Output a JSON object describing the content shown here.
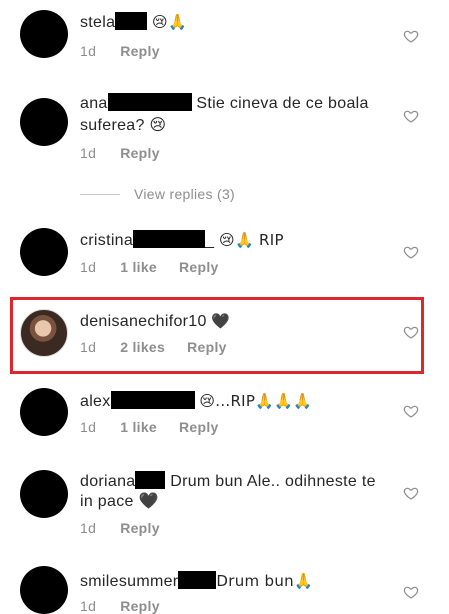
{
  "comments": [
    {
      "username": "stela",
      "text": "😢🙏",
      "time": "1d",
      "likes": "",
      "reply": "Reply"
    },
    {
      "username": "ana",
      "text": "Stie cineva de ce boala suferea? 😢",
      "line1": "Stie cineva de ce boala",
      "line2": "suferea? 😢",
      "time": "1d",
      "likes": "",
      "reply": "Reply"
    },
    {
      "username": "cristina",
      "suffix": "_",
      "text": "😢🙏 RIP",
      "time": "1d",
      "likes": "1 like",
      "reply": "Reply"
    },
    {
      "username": "denisanechifor10",
      "text": "🖤",
      "time": "1d",
      "likes": "2 likes",
      "reply": "Reply"
    },
    {
      "username": "alex",
      "text": "😢...RIP🙏🙏🙏",
      "time": "1d",
      "likes": "1 like",
      "reply": "Reply"
    },
    {
      "username": "doriana",
      "line1": "Drum bun Ale.. odihneste te",
      "line2": "in pace 🖤",
      "time": "1d",
      "likes": "",
      "reply": "Reply"
    },
    {
      "username": "smilesummer",
      "text": "Drum bun🙏",
      "time": "1d",
      "likes": "",
      "reply": "Reply"
    }
  ],
  "view_replies": "View replies (3)",
  "icons": {
    "heart": "heart-outline-icon"
  },
  "colors": {
    "highlight": "#e0262d",
    "meta": "#8e8e8e"
  }
}
